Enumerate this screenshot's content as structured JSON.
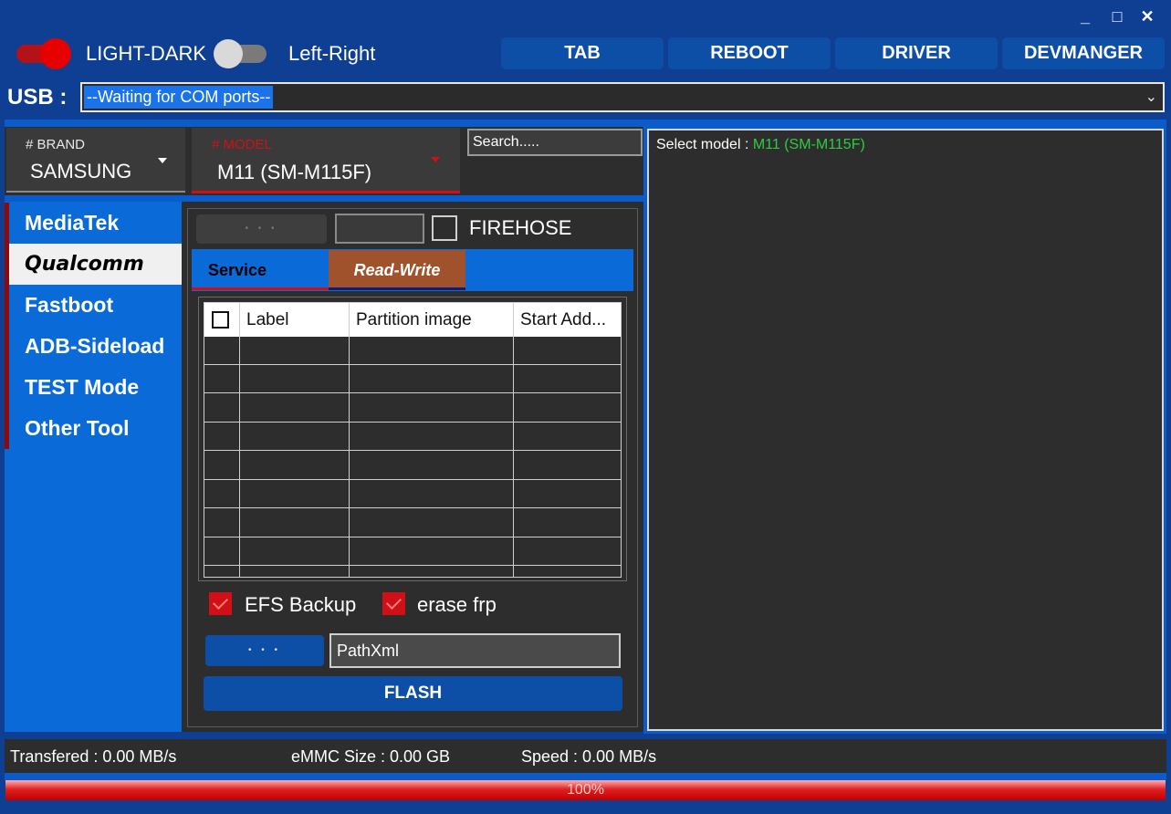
{
  "window": {
    "minimize": "_",
    "maximize": "□",
    "close": "✕"
  },
  "toggles": {
    "light_dark_label": "LIGHT-DARK",
    "left_right_label": "Left-Right"
  },
  "toolbar": {
    "tab": "TAB",
    "reboot": "REBOOT",
    "driver": "DRIVER",
    "devmanger": "DEVMANGER"
  },
  "usb": {
    "label": "USB :",
    "value": "--Waiting for COM ports--"
  },
  "brand": {
    "label": "# BRAND",
    "value": "SAMSUNG"
  },
  "model": {
    "label": "# MODEL",
    "value": "M11 (SM-M115F)"
  },
  "search": {
    "placeholder": "Search....."
  },
  "sidebar": {
    "items": [
      {
        "label": "MediaTek"
      },
      {
        "label": "Qualcomm"
      },
      {
        "label": "Fastboot"
      },
      {
        "label": "ADB-Sideload"
      },
      {
        "label": "TEST Mode"
      },
      {
        "label": "Other Tool"
      }
    ]
  },
  "qualcomm": {
    "dots": "• • •",
    "firehose_label": "FIREHOSE",
    "tabs": [
      {
        "label": "Service"
      },
      {
        "label": "Read-Write"
      }
    ],
    "table": {
      "columns": [
        "Label",
        "Partition image",
        "Start Add..."
      ]
    },
    "efs_backup_label": "EFS Backup",
    "erase_frp_label": "erase frp",
    "path_dots": "• • •",
    "path_value": "PathXml",
    "flash_label": "FLASH"
  },
  "log": {
    "prefix": "Select model : ",
    "model": "M11 (SM-M115F)"
  },
  "status": {
    "transfered": "Transfered : 0.00 MB/s",
    "emmc": "eMMC Size : 0.00 GB",
    "speed": "Speed : 0.00 MB/s"
  },
  "progress": {
    "label": "100%",
    "value": 1.0
  },
  "colors": {
    "frame_blue": "#0e3f93",
    "accent_blue": "#0a6ad8",
    "dark": "#2d2d2d",
    "red": "#d01016",
    "green_text": "#2ecc40"
  }
}
